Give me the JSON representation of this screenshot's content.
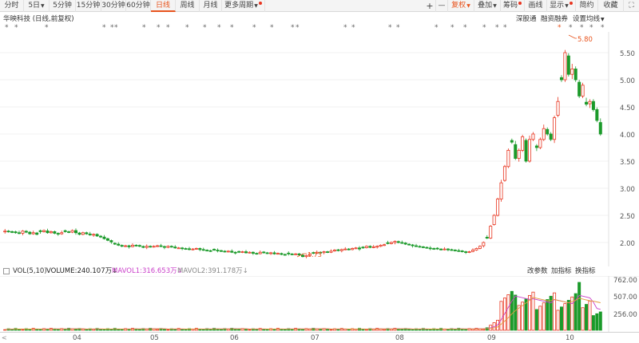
{
  "toolbar": {
    "periods": [
      "分时",
      "5日",
      "5分钟",
      "15分钟",
      "30分钟",
      "60分钟",
      "日线",
      "周线",
      "月线",
      "更多周期"
    ],
    "active_period": "日线",
    "zoom_in": "+",
    "zoom_out": "—",
    "restore_rights": "复权",
    "overlay": "叠加",
    "chips": "筹码",
    "draw_line": "画线",
    "display": "显示",
    "brief": "简约",
    "favorite": "收藏",
    "expand": "⛶"
  },
  "header": {
    "stock_title": "华映科技 (日线,前复权)",
    "connect": "深股通",
    "margin": "融资融券",
    "set_ma": "设置均线"
  },
  "stars": {
    "symbol": "*"
  },
  "price_axis": {
    "labels": [
      "5.50",
      "5.00",
      "4.50",
      "4.00",
      "3.50",
      "3.00",
      "2.50",
      "2.00"
    ],
    "high_marker": "5.80",
    "low_marker": "1.73"
  },
  "volume": {
    "checkbox_label": "",
    "vol_label": "VOL(5,10)",
    "volume_value": "VOLUME:240.107万↓",
    "mavol1": "MAVOL1:316.653万↓",
    "mavol2": "MAVOL2:391.178万↓",
    "axis_labels": [
      "762.00",
      "507.00",
      "256.00"
    ],
    "change_params": "改参数",
    "add_indicator": "加指标",
    "switch_indicator": "换指标"
  },
  "x_axis": {
    "months": [
      "04",
      "05",
      "06",
      "07",
      "08",
      "09",
      "10"
    ]
  },
  "colors": {
    "up": "#e8341e",
    "down": "#1b9a2a",
    "ma5": "#e39c3c",
    "ma10": "#c93ec9"
  },
  "chart_data": {
    "type": "candlestick",
    "price_range": [
      1.55,
      5.85
    ],
    "high": 5.8,
    "low": 1.73,
    "months": [
      "04",
      "05",
      "06",
      "07",
      "08",
      "09",
      "10"
    ],
    "closes": [
      2.21,
      2.2,
      2.19,
      2.18,
      2.17,
      2.21,
      2.19,
      2.16,
      2.18,
      2.15,
      2.2,
      2.22,
      2.18,
      2.2,
      2.17,
      2.16,
      2.18,
      2.2,
      2.19,
      2.22,
      2.18,
      2.15,
      2.18,
      2.16,
      2.14,
      2.15,
      2.12,
      2.1,
      2.07,
      2.04,
      2.01,
      1.97,
      1.95,
      1.93,
      1.94,
      1.92,
      1.95,
      1.94,
      1.93,
      1.91,
      1.93,
      1.92,
      1.93,
      1.94,
      1.93,
      1.91,
      1.93,
      1.92,
      1.9,
      1.9,
      1.89,
      1.88,
      1.87,
      1.88,
      1.89,
      1.87,
      1.86,
      1.85,
      1.84,
      1.86,
      1.85,
      1.84,
      1.83,
      1.84,
      1.82,
      1.81,
      1.82,
      1.83,
      1.81,
      1.82,
      1.8,
      1.79,
      1.82,
      1.81,
      1.8,
      1.81,
      1.79,
      1.8,
      1.78,
      1.77,
      1.79,
      1.78,
      1.79,
      1.77,
      1.74,
      1.76,
      1.79,
      1.8,
      1.82,
      1.81,
      1.83,
      1.82,
      1.84,
      1.86,
      1.85,
      1.87,
      1.88,
      1.87,
      1.89,
      1.9,
      1.88,
      1.9,
      1.93,
      1.91,
      1.92,
      1.93,
      1.95,
      1.96,
      1.98,
      2.0,
      2.02,
      2.0,
      1.99,
      1.97,
      1.96,
      1.94,
      1.93,
      1.92,
      1.91,
      1.9,
      1.89,
      1.88,
      1.88,
      1.87,
      1.88,
      1.87,
      1.86,
      1.85,
      1.84,
      1.83,
      1.82,
      1.83,
      1.86,
      1.89,
      1.93,
      2.0,
      2.08,
      2.3,
      2.5,
      2.8,
      3.1,
      3.4,
      3.7,
      3.85,
      3.55,
      3.7,
      3.95,
      3.5,
      3.9,
      4.0,
      3.75,
      3.9,
      4.1,
      4.0,
      3.9,
      4.3,
      4.6,
      5.0,
      5.5,
      5.1,
      5.2,
      5.0,
      4.7,
      4.9,
      4.55,
      4.6,
      4.45,
      4.25,
      4.0
    ]
  }
}
